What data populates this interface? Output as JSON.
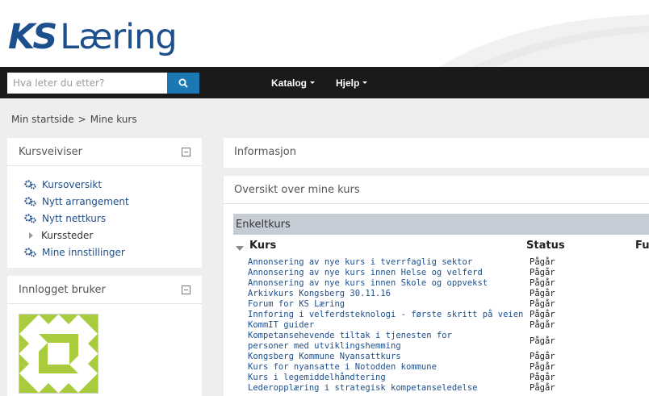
{
  "logo": {
    "ks": "KS",
    "rest": "Læring"
  },
  "search": {
    "placeholder": "Hva leter du etter?"
  },
  "nav": {
    "katalog": "Katalog",
    "hjelp": "Hjelp"
  },
  "breadcrumb": {
    "home": "Min startside",
    "separator": ">",
    "current": "Mine kurs"
  },
  "kursveiviser": {
    "title": "Kursveiviser",
    "items": [
      {
        "label": "Kursoversikt",
        "icon": "gears-icon"
      },
      {
        "label": "Nytt arrangement",
        "icon": "gears-icon"
      },
      {
        "label": "Nytt nettkurs",
        "icon": "gears-icon"
      },
      {
        "label": "Kurssteder",
        "icon": "expand-triangle-icon"
      },
      {
        "label": "Mine innstillinger",
        "icon": "gears-icon"
      }
    ]
  },
  "innlogget": {
    "title": "Innlogget bruker"
  },
  "informasjon": {
    "title": "Informasjon"
  },
  "oversikt": {
    "title": "Oversikt over mine kurs"
  },
  "enkeltkurs": {
    "title": "Enkeltkurs",
    "columns": {
      "kurs": "Kurs",
      "status": "Status",
      "fu": "Fu"
    },
    "rows": [
      {
        "name": "Annonsering av nye kurs i tverrfaglig sektor",
        "status": "Pågår"
      },
      {
        "name": "Annonsering av nye kurs innen Helse og velferd",
        "status": "Pågår"
      },
      {
        "name": "Annonsering av nye kurs innen Skole og oppvekst",
        "status": "Pågår"
      },
      {
        "name": "Arkivkurs Kongsberg 30.11.16",
        "status": "Pågår"
      },
      {
        "name": "Forum for KS Læring",
        "status": "Pågår"
      },
      {
        "name": "Innforing i velferdsteknologi - første skritt på veien",
        "status": "Pågår"
      },
      {
        "name": "KommIT guider",
        "status": "Pågår"
      },
      {
        "name": "Kompetansehevende tiltak i tjenesten for personer med utviklingshemming",
        "status": "Pågår",
        "two_line": true
      },
      {
        "name": "Kongsberg Kommune Nyansattkurs",
        "status": "Pågår"
      },
      {
        "name": "Kurs for nyansatte i Notodden kommune",
        "status": "Pågår"
      },
      {
        "name": "Kurs i legemiddelhåndtering",
        "status": "Pågår"
      },
      {
        "name": "Lederopplæring i strategisk kompetanseledelse",
        "status": "Pågår"
      }
    ]
  },
  "colors": {
    "brand": "#1d4f8c",
    "navbar": "#1a1a1a",
    "search_button": "#1c78b2",
    "section_header": "#c5ccd6"
  }
}
